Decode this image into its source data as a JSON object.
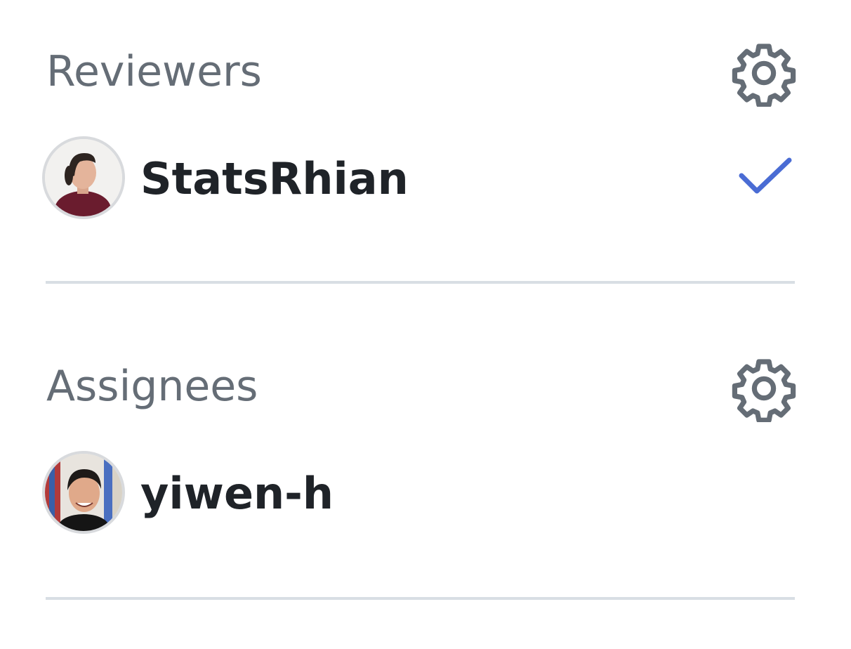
{
  "reviewers": {
    "title": "Reviewers",
    "settings_icon": "gear-icon",
    "people": [
      {
        "login": "StatsRhian",
        "status_icon": "check-icon",
        "status_color": "#4a6cd4"
      }
    ]
  },
  "assignees": {
    "title": "Assignees",
    "settings_icon": "gear-icon",
    "people": [
      {
        "login": "yiwen-h"
      }
    ]
  },
  "colors": {
    "heading": "#656d76",
    "name": "#1f2328",
    "divider": "#d8dee4",
    "accent": "#4a6cd4"
  }
}
